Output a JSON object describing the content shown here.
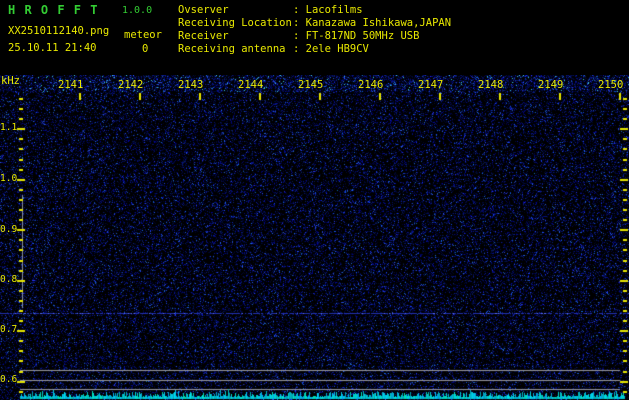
{
  "header": {
    "app_title": "H R O F F T",
    "app_version": "1.0.0",
    "filename": "XX2510112140.png",
    "counter_label": "meteor",
    "counter_value": "0",
    "timestamp": "25.10.11 21:40",
    "info": [
      {
        "label": "Ovserver",
        "value": ": Lacofilms"
      },
      {
        "label": "Receiving Location",
        "value": ": Kanazawa Ishikawa,JAPAN"
      },
      {
        "label": "Receiver",
        "value": ": FT-817ND 50MHz USB"
      },
      {
        "label": "Receiving antenna",
        "value": ": 2ele HB9CV"
      }
    ]
  },
  "spectrogram": {
    "freq_axis_unit": "kHz",
    "time_labels": [
      "2141",
      "2142",
      "2143",
      "2144",
      "2145",
      "2146",
      "2147",
      "2148",
      "2149",
      "2150"
    ],
    "freq_labels": [
      "1.1",
      "1.0",
      "0.9",
      "0.8",
      "0.7",
      "0.6"
    ]
  },
  "colors": {
    "background": "#000000",
    "text_yellow": "#e8e800",
    "title_green": "#33cc33",
    "noise_blue": "#2233cc",
    "signal_cyan": "#00d8d8",
    "line_gray": "#9a9aa0"
  }
}
